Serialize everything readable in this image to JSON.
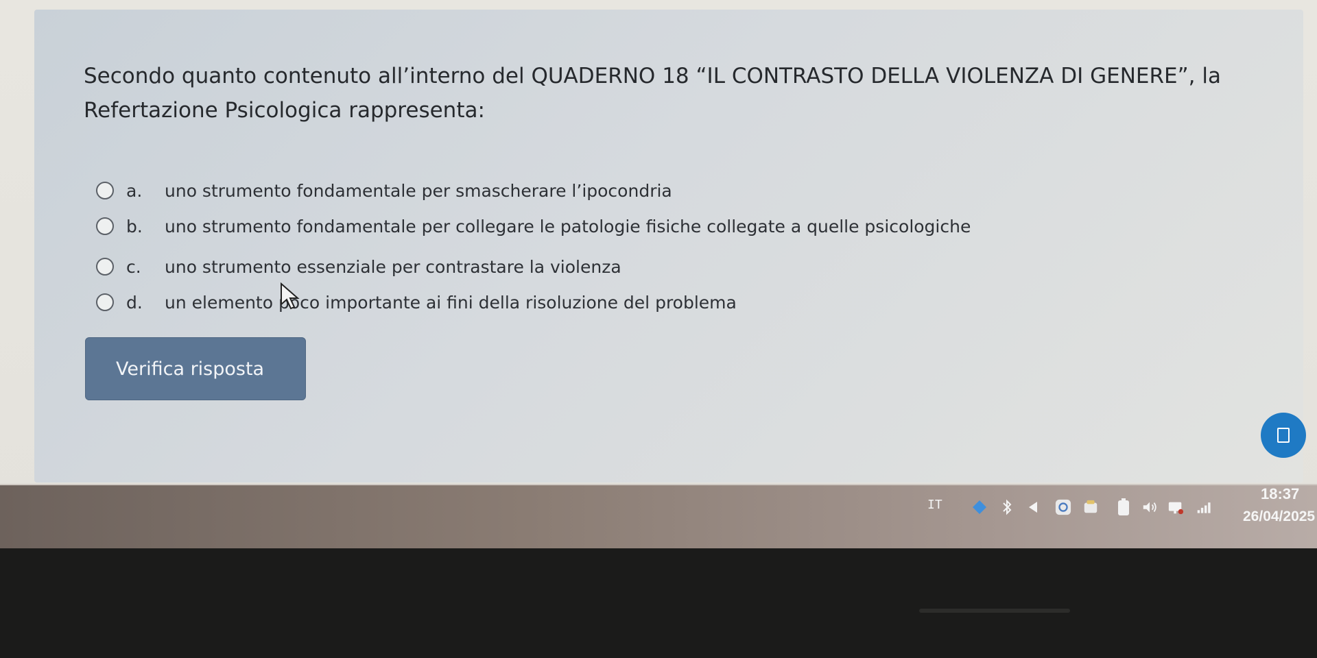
{
  "question": {
    "text": "Secondo quanto contenuto all’interno del QUADERNO 18 “IL CONTRASTO DELLA VIOLENZA DI GENERE”, la Refertazione Psicologica rappresenta:"
  },
  "options": [
    {
      "letter": "a.",
      "text": "uno strumento fondamentale per smascherare l’ipocondria"
    },
    {
      "letter": "b.",
      "text": "uno strumento fondamentale per collegare le patologie fisiche collegate a quelle psicologiche"
    },
    {
      "letter": "c.",
      "text": "uno strumento essenziale per contrastare la violenza"
    },
    {
      "letter": "d.",
      "text": "un elemento poco importante ai fini della risoluzione del problema"
    }
  ],
  "verify_button": {
    "label": "Verifica risposta"
  },
  "taskbar": {
    "language": "IT",
    "time": "18:37",
    "date": "26/04/2025"
  },
  "colors": {
    "accent": "#5c7694",
    "chat_fab": "#1f7ac4"
  }
}
